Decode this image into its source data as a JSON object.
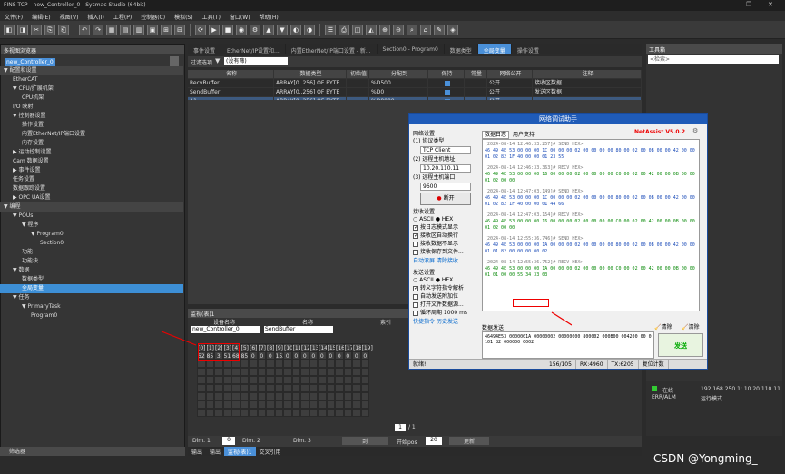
{
  "title": "FINS TCP - new_Controller_0 - Sysmac Studio (64bit)",
  "menu": [
    "文件(F)",
    "编辑(E)",
    "视图(V)",
    "插入(I)",
    "工程(P)",
    "控制器(C)",
    "模拟(S)",
    "工具(T)",
    "窗口(W)",
    "帮助(H)"
  ],
  "explorer": {
    "title": "多视图浏览器",
    "device": "new_Controller_0 ▾",
    "items": [
      {
        "t": "▼ 配置和设置",
        "lv": 0,
        "hdr": true
      },
      {
        "t": "EtherCAT",
        "lv": 1
      },
      {
        "t": "▼ CPU/扩展机架",
        "lv": 1
      },
      {
        "t": "CPU机架",
        "lv": 2
      },
      {
        "t": "I/O 映射",
        "lv": 1
      },
      {
        "t": "▼ 控制器设置",
        "lv": 1
      },
      {
        "t": "操作设置",
        "lv": 2
      },
      {
        "t": "内置EtherNet/IP端口设置",
        "lv": 2
      },
      {
        "t": "内存设置",
        "lv": 2
      },
      {
        "t": "▶ 运动控制设置",
        "lv": 1
      },
      {
        "t": "Cam 数据设置",
        "lv": 1
      },
      {
        "t": "▶ 事件设置",
        "lv": 1
      },
      {
        "t": "任务设置",
        "lv": 1
      },
      {
        "t": "数据跟踪设置",
        "lv": 1
      },
      {
        "t": "▶ OPC UA设置",
        "lv": 1
      },
      {
        "t": "▼ 编程",
        "lv": 0,
        "hdr": true
      },
      {
        "t": "▼ POUs",
        "lv": 1
      },
      {
        "t": "▼ 程序",
        "lv": 2
      },
      {
        "t": "▼ Program0",
        "lv": 3
      },
      {
        "t": "Section0",
        "lv": 4
      },
      {
        "t": "功能",
        "lv": 2
      },
      {
        "t": "功能块",
        "lv": 2
      },
      {
        "t": "▼ 数据",
        "lv": 1
      },
      {
        "t": "数据类型",
        "lv": 2
      },
      {
        "t": "全局变量",
        "lv": 2,
        "sel": true
      },
      {
        "t": "▼ 任务",
        "lv": 1
      },
      {
        "t": "▼ PrimaryTask",
        "lv": 2
      },
      {
        "t": "Program0",
        "lv": 3
      }
    ],
    "filter": "筛选器"
  },
  "tabs": [
    {
      "l": "事件设置"
    },
    {
      "l": "EtherNet/IP设置和..."
    },
    {
      "l": "内置EtherNet/IP端口设置 - 新..."
    },
    {
      "l": "Section0 - Program0"
    },
    {
      "l": "数据类型"
    },
    {
      "l": "全局变量",
      "a": true
    },
    {
      "l": "操作设置"
    }
  ],
  "vars": {
    "filter": "过滤选项",
    "filter_val": "(没有筛)",
    "headers": [
      "名称",
      "数据类型",
      "初始值",
      "分配到",
      "保持",
      "常量",
      "网络公开",
      "注释"
    ],
    "rows": [
      [
        "RecvBuffer",
        "ARRAY[0..256] OF BYTE",
        "",
        "%D500",
        "✓",
        "",
        "公开",
        "接收区数据"
      ],
      [
        "SendBuffer",
        "ARRAY[0..256] OF BYTE",
        "",
        "%D0",
        "✓",
        "",
        "公开",
        "发送区数据"
      ],
      [
        "A1",
        "ARRAY[0..256] OF BYTE",
        "",
        "%D8000",
        "✓",
        "",
        "公开",
        ""
      ]
    ]
  },
  "watch": {
    "title": "监视(表)1",
    "device_h": "设备名称",
    "name_h": "名称",
    "index_h": "索引",
    "device": "new_Controller_0",
    "name": "SendBuffer",
    "idx": [
      "[0]",
      "[1]",
      "[2]",
      "[3]",
      "[4]",
      "[5]",
      "[6]",
      "[7]",
      "[8]",
      "[9]",
      "[10]",
      "[11]",
      "[12]",
      "[13]",
      "[14]",
      "[15]",
      "[16]",
      "[17]",
      "[18]",
      "[19]"
    ],
    "vals": [
      "52",
      "85",
      "3",
      "51",
      "68",
      "85",
      "0",
      "0",
      "0",
      "153",
      "0",
      "0",
      "0",
      "0",
      "0",
      "0",
      "0",
      "0",
      "0",
      "0"
    ],
    "page": "1",
    "total": "/ 1",
    "dim1": "Dim. 1",
    "dim1_v": "0",
    "dim2": "Dim. 2",
    "dim3": "Dim. 3",
    "to": "到",
    "pos": "开始pos",
    "pos_v": "20",
    "update": "更新"
  },
  "bottom_tabs": [
    "输出",
    "输出",
    "监视(表)1",
    "交叉引用"
  ],
  "netassist": {
    "title": "网络调试助手",
    "brand": "NetAssist V5.0.2",
    "net": "网络设置",
    "proto_l": "(1) 协议类型",
    "proto": "TCP Client",
    "host_l": "(2) 远程主机地址",
    "host": "10.20.110.11",
    "port_l": "(3) 远程主机端口",
    "port": "9600",
    "disconnect": "断开",
    "recv_l": "接收设置",
    "ascii": "ASCII",
    "hex": "HEX",
    "recv_opts": [
      {
        "t": "按日志模式显示",
        "c": true
      },
      {
        "t": "接收区自动换行",
        "c": true
      },
      {
        "t": "接收数据不显示",
        "c": false
      },
      {
        "t": "接收保存到文件...",
        "c": false
      }
    ],
    "recv_links": [
      "自动滚屏",
      "清除接收"
    ],
    "send_l": "发送设置",
    "send_opts": [
      {
        "t": "转义字符指令解析",
        "c": true
      },
      {
        "t": "自动发送附加位",
        "c": false
      },
      {
        "t": "打开文件数据源...",
        "c": false
      },
      {
        "t": "循环周期 1000 ms",
        "c": false
      }
    ],
    "send_links": [
      "快捷指令",
      "历史发送"
    ],
    "log_tabs": [
      "数据日志",
      "用户支持"
    ],
    "log": [
      {
        "ts": "[2024-08-14 12:46:33.257]# SEND HEX>",
        "d": "46 49 4E 53 00 00 00 1C 00 00 00 02 00 00 00 00 80 00 02 00 0B 00 00 42 00 00 01 02 82 1F 40 00 00 01 23 55",
        "b": true
      },
      {
        "ts": "[2024-08-14 12:46:33.363]# RECV HEX>",
        "d": "46 49 4E 53 00 00 00 16 00 00 00 02 00 00 00 00 C0 00 02 00 42 00 00 0B 00 00 01 02 00 00",
        "b": false
      },
      {
        "ts": "[2024-08-14 12:47:03.149]# SEND HEX>",
        "d": "46 49 4E 53 00 00 00 1C 00 00 00 02 00 00 00 00 80 00 02 00 0B 00 00 42 00 00 01 02 82 1F 40 00 00 01 44 66",
        "b": true
      },
      {
        "ts": "[2024-08-14 12:47:03.154]# RECV HEX>",
        "d": "46 49 4E 53 00 00 00 16 00 00 00 02 00 00 00 00 C0 00 02 00 42 00 00 0B 00 00 01 02 00 00",
        "b": false
      },
      {
        "ts": "[2024-08-14 12:55:36.746]# SEND HEX>",
        "d": "46 49 4E 53 00 00 00 1A 00 00 00 02 00 00 00 00 80 00 02 00 0B 00 00 42 00 00 01 01 82 00 00 00 00 02",
        "b": true
      },
      {
        "ts": "[2024-08-14 12:55:36.752]# RECV HEX>",
        "d": "46 49 4E 53 00 00 00 1A 00 00 00 02 00 00 00 00 C0 00 02 00 42 00 00 0B 00 00 01 01 00 00 55 34 33 03",
        "b": false
      }
    ],
    "send_area_l": "数据发送",
    "clear": "清除",
    "clear2": "清除",
    "send_data": "46494E53 0000001A 00000002 00000000 800002 000B00 004200 00 0101 82 000000 0002",
    "send_btn": "发送",
    "status": [
      "就绪!",
      "156/105",
      "RX:4960",
      "TX:6205",
      "复位计数"
    ]
  },
  "toolbox": {
    "title": "工具箱",
    "search": "<检索>"
  },
  "plc": {
    "online": "在线",
    "ip": "192.168.250.1; 10.20.110.11",
    "err": "ERR/ALM",
    "run": "运行模式"
  },
  "watermark": "CSDN @Yongming_"
}
